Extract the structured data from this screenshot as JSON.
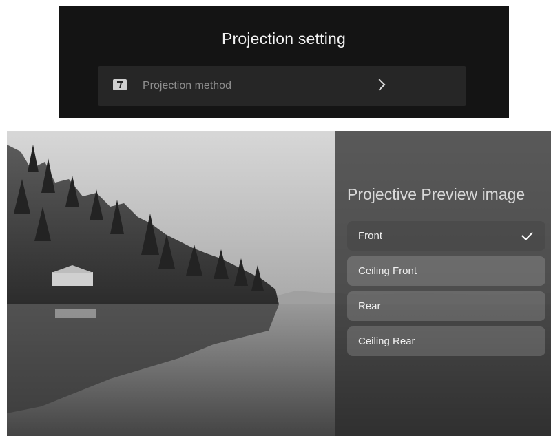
{
  "projection_setting": {
    "title": "Projection setting",
    "method_item": {
      "label": "Projection method",
      "icon": "projection-method-icon",
      "arrow_icon": "chevron-right-icon"
    }
  },
  "preview_panel": {
    "title": "Projective Preview image",
    "options": [
      {
        "label": "Front",
        "selected": true
      },
      {
        "label": "Ceiling Front",
        "selected": false
      },
      {
        "label": "Rear",
        "selected": false
      },
      {
        "label": "Ceiling Rear",
        "selected": false
      }
    ],
    "check_icon": "checkmark-icon"
  },
  "colors": {
    "top_panel_bg": "#141414",
    "row_bg": "#262626",
    "panel_overlay": "#282828"
  }
}
